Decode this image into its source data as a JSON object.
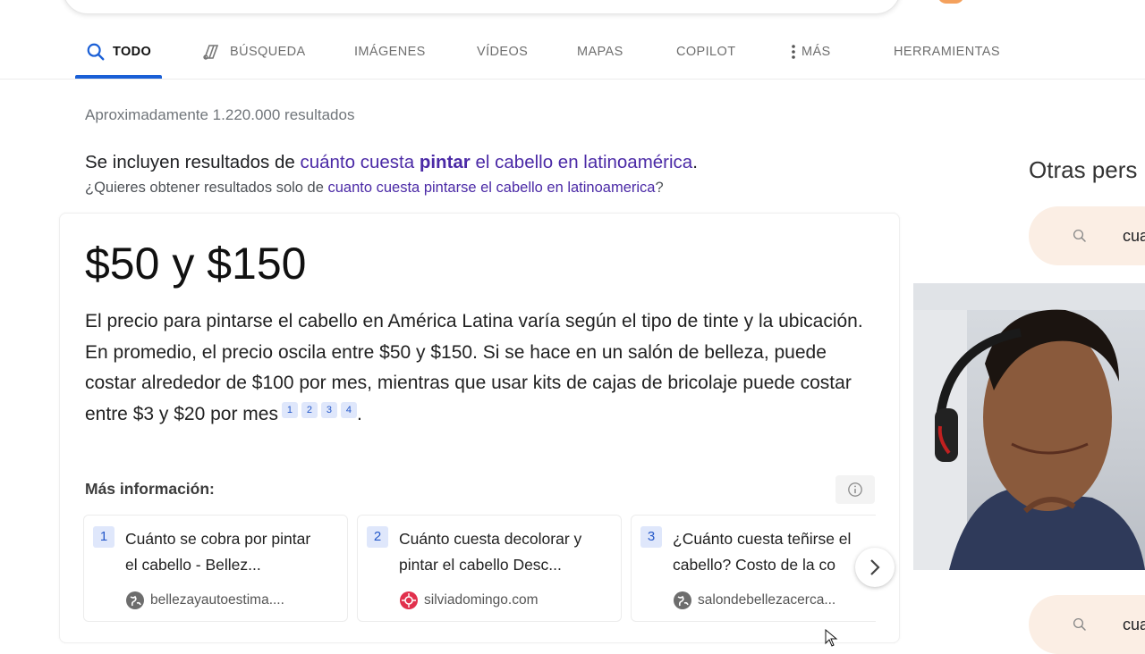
{
  "tabs": [
    {
      "label": "TODO",
      "icon": "search-icon",
      "active": true
    },
    {
      "label": "BÚSQUEDA",
      "icon": "copilot-search-icon"
    },
    {
      "label": "IMÁGENES"
    },
    {
      "label": "VÍDEOS"
    },
    {
      "label": "MAPAS"
    },
    {
      "label": "COPILOT"
    },
    {
      "label": "MÁS",
      "icon": "more-vertical-icon"
    },
    {
      "label": "HERRAMIENTAS"
    }
  ],
  "results_count": "Aproximadamente 1.220.000 resultados",
  "spelling": {
    "prefix": "Se incluyen resultados de",
    "corrected_before": "cuánto cuesta",
    "corrected_bold": "pintar",
    "corrected_after": "el cabello en latinoamérica",
    "suffix": ".",
    "alt_prefix": "¿Quieres obtener resultados solo de",
    "alt_query": "cuanto cuesta pintarse el cabello en latinoamerica",
    "alt_suffix": "?"
  },
  "answer": {
    "headline": "$50 y $150",
    "text": "El precio para pintarse el cabello en América Latina varía según el tipo de tinte y la ubicación. En promedio, el precio oscila entre $50 y $150. Si se hace en un salón de belleza, puede costar alrededor de $100 por mes, mientras que usar kits de cajas de bricolaje puede costar entre $3 y $20 por mes",
    "citations": [
      "1",
      "2",
      "3",
      "4"
    ],
    "end": "."
  },
  "more_info_label": "Más información:",
  "sources": [
    {
      "num": "1",
      "line1": "Cuánto se cobra por pintar",
      "line2": "el cabello - Bellez...",
      "site": "bellezayautoestima....",
      "favicon_color": "#6d6d6d"
    },
    {
      "num": "2",
      "line1": "Cuánto cuesta decolorar y",
      "line2": "pintar el cabello Desc...",
      "site": "silviadomingo.com",
      "favicon_color": "#e1304c"
    },
    {
      "num": "3",
      "line1": "¿Cuánto cuesta teñirse el",
      "line2": "cabello? Costo de la co",
      "site": "salondebellezacerca...",
      "favicon_color": "#6d6d6d"
    }
  ],
  "sidebar": {
    "title": "Otras pers",
    "related": [
      "cua",
      "cua"
    ]
  },
  "colors": {
    "accent": "#1a5fd6",
    "link": "#4b2aa6",
    "pill": "#fbeee4"
  }
}
